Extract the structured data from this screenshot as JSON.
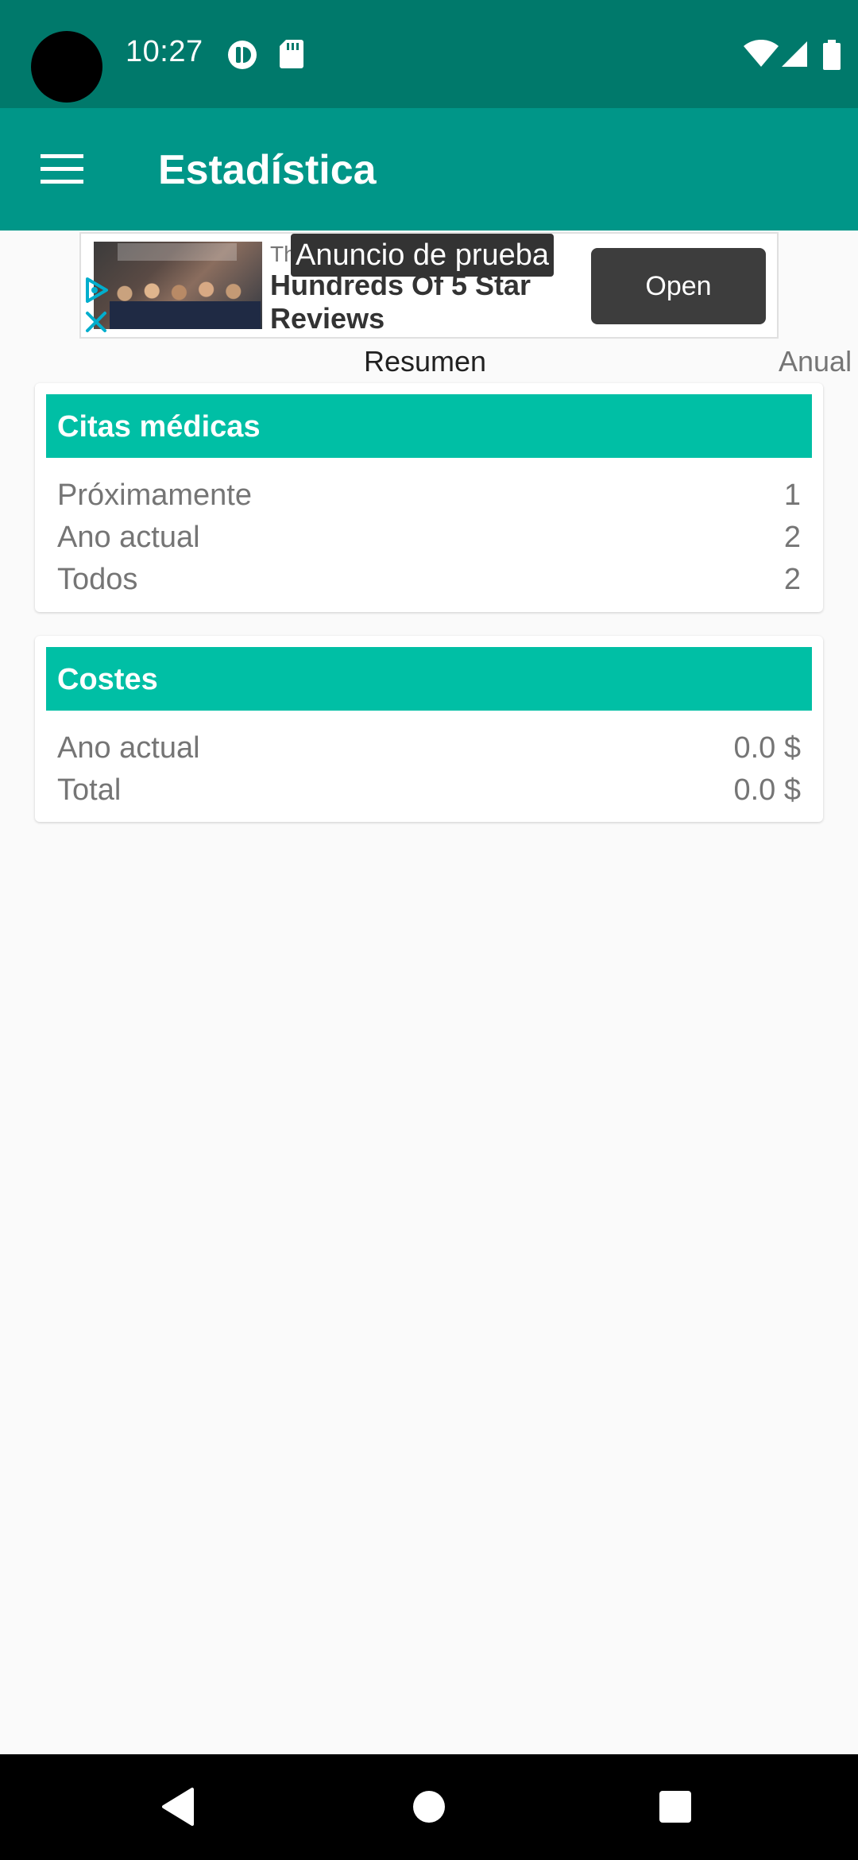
{
  "status_bar": {
    "time": "10:27",
    "icons": [
      "camera-cutout",
      "app-notification-icon",
      "sd-card-icon",
      "wifi-icon",
      "cell-signal-icon",
      "battery-icon"
    ]
  },
  "app_bar": {
    "title": "Estadística",
    "menu_icon": "hamburger-menu-icon"
  },
  "ad": {
    "label": "Anuncio de prueba",
    "headline_prefix": "Th",
    "headline": "Hundreds Of 5 Star Reviews",
    "button_label": "Open",
    "icons": [
      "adchoices-icon",
      "close-icon"
    ]
  },
  "tabs": [
    {
      "label": "Resumen",
      "selected": true
    },
    {
      "label": "Anual",
      "selected": false
    }
  ],
  "cards": [
    {
      "title": "Citas médicas",
      "rows": [
        {
          "label": "Próximamente",
          "value": "1"
        },
        {
          "label": "Ano actual",
          "value": "2"
        },
        {
          "label": "Todos",
          "value": "2"
        }
      ]
    },
    {
      "title": "Costes",
      "rows": [
        {
          "label": "Ano actual",
          "value": "0.0 $"
        },
        {
          "label": "Total",
          "value": "0.0 $"
        }
      ]
    }
  ],
  "nav_bar": {
    "buttons": [
      "back-icon",
      "home-icon",
      "recents-icon"
    ]
  },
  "colors": {
    "status_bar": "#00796b",
    "app_bar": "#009688",
    "card_header": "#00bfa5",
    "background": "#fafafa"
  }
}
